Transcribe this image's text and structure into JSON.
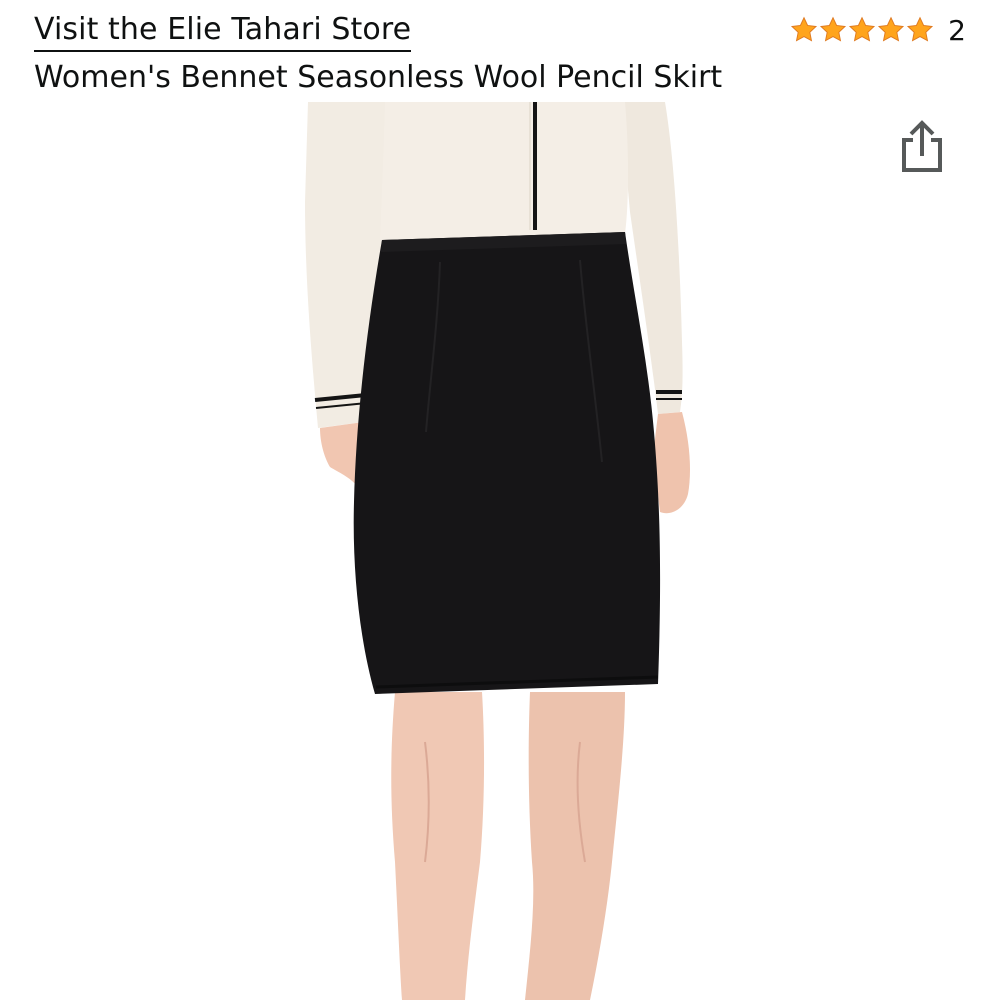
{
  "header": {
    "store_link": "Visit the Elie Tahari Store",
    "product_title": "Women's Bennet Seasonless Wool Pencil Skirt"
  },
  "rating": {
    "stars": 5,
    "max_stars": 5,
    "count": "2",
    "star_color": "#ffa41c"
  },
  "share": {
    "icon": "share-icon"
  },
  "product_image": {
    "subject": "model wearing black pencil skirt with cream blouse"
  },
  "colors": {
    "text": "#0f1111",
    "icon": "#565959",
    "skirt": "#161517",
    "blouse": "#f2ece3"
  }
}
